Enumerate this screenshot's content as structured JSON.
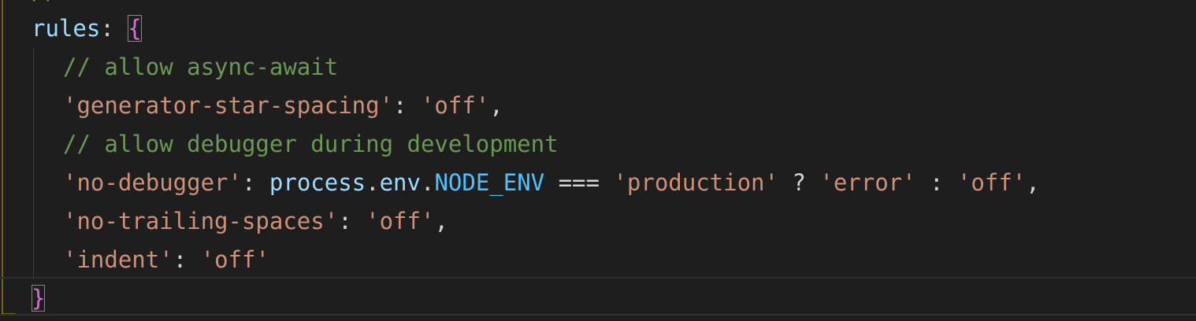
{
  "editor": {
    "theme_colors": {
      "background": "#1e1e1e",
      "property": "#9cdcfe",
      "comment": "#6a9955",
      "string": "#ce9178",
      "constant": "#4fc1ff",
      "bracket": "#da70d6",
      "indent_guide": "#b5a200"
    },
    "partial_line": "// ...",
    "lines": [
      {
        "key": "rules",
        "colon": ": ",
        "open_brace": "{"
      },
      {
        "comment": "// allow async-await"
      },
      {
        "prop": "'generator-star-spacing'",
        "colon": ": ",
        "value": "'off'",
        "comma": ","
      },
      {
        "comment": "// allow debugger during development"
      },
      {
        "prop": "'no-debugger'",
        "colon": ": ",
        "obj": "process",
        "dot1": ".",
        "member": "env",
        "dot2": ".",
        "const": "NODE_ENV",
        "op_eq": " === ",
        "cmp": "'production'",
        "op_q": " ? ",
        "then": "'error'",
        "op_c": " : ",
        "else": "'off'",
        "comma": ","
      },
      {
        "prop": "'no-trailing-spaces'",
        "colon": ": ",
        "value": "'off'",
        "comma": ","
      },
      {
        "prop": "'indent'",
        "colon": ": ",
        "value": "'off'"
      },
      {
        "close_brace": "}"
      }
    ]
  }
}
